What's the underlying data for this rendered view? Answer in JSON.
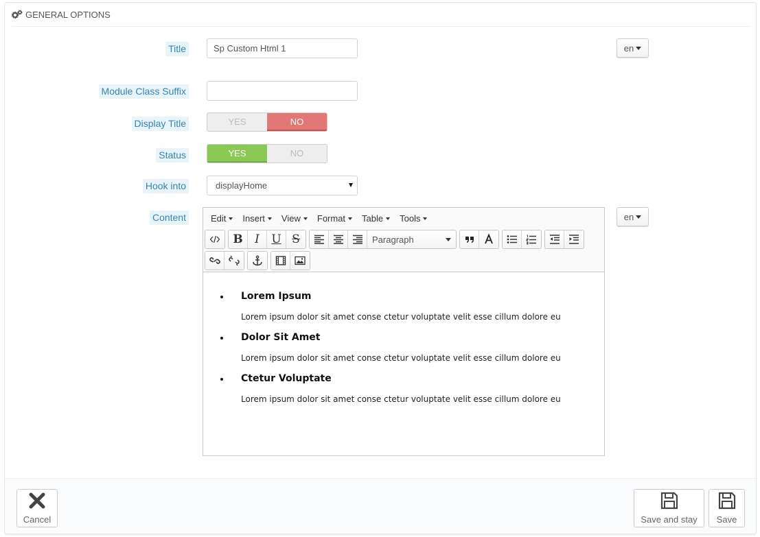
{
  "panel": {
    "heading": "General Options"
  },
  "form": {
    "title_label": "Title",
    "title_value": "Sp Custom Html 1",
    "lang": "en",
    "suffix_label": "Module Class Suffix",
    "suffix_value": "",
    "display_title_label": "Display Title",
    "display_title": {
      "yes": "YES",
      "no": "NO",
      "selected": "no"
    },
    "status_label": "Status",
    "status": {
      "yes": "YES",
      "no": "NO",
      "selected": "yes"
    },
    "hook_label": "Hook into",
    "hook_value": "displayHome",
    "content_label": "Content",
    "content_lang": "en"
  },
  "editor": {
    "menus": [
      "Edit",
      "Insert",
      "View",
      "Format",
      "Table",
      "Tools"
    ],
    "format_value": "Paragraph",
    "items": [
      {
        "heading": "Lorem Ipsum",
        "text": "Lorem ipsum dolor sit amet conse ctetur voluptate velit esse cillum dolore eu"
      },
      {
        "heading": "Dolor Sit Amet",
        "text": "Lorem ipsum dolor sit amet conse ctetur voluptate velit esse cillum dolore eu"
      },
      {
        "heading": "Ctetur Voluptate",
        "text": "Lorem ipsum dolor sit amet conse ctetur voluptate velit esse cillum dolore eu"
      }
    ]
  },
  "footer": {
    "cancel": "Cancel",
    "save_stay": "Save and stay",
    "save": "Save"
  },
  "colors": {
    "label_bg": "#e8f3fa",
    "label_text": "#3586ae",
    "no_red": "#e17875",
    "yes_green": "#8bc954"
  }
}
